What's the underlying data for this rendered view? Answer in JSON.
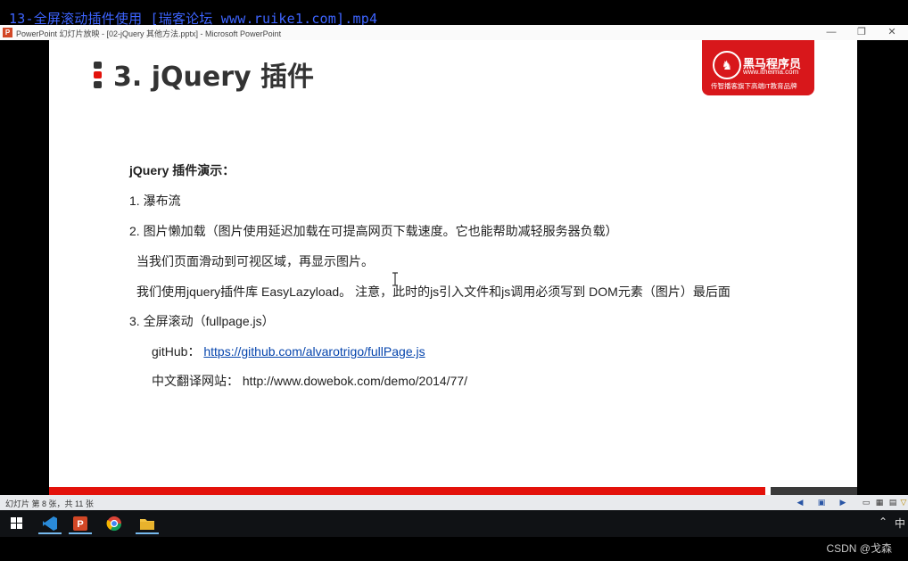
{
  "video_title": "13-全屏滚动插件使用_[瑞客论坛 www.ruike1.com].mp4",
  "window": {
    "title": "PowerPoint 幻灯片放映 - [02-jQuery 其他方法.pptx] - Microsoft PowerPoint",
    "app_icon": "P",
    "minimize": "—",
    "restore": "❐",
    "close": "✕"
  },
  "slide": {
    "title": "3. jQuery 插件",
    "logo": {
      "name": "黑马程序员",
      "url": "www.itheima.com",
      "slogan": "传智播客旗下高端IT教育品牌"
    },
    "heading": "jQuery 插件演示：",
    "item1": "1. 瀑布流",
    "item2": "2. 图片懒加载（图片使用延迟加载在可提高网页下载速度。它也能帮助减轻服务器负载）",
    "item2_line1": "当我们页面滑动到可视区域，再显示图片。",
    "item2_line2": "我们使用jquery插件库  EasyLazyload。 注意，此时的js引入文件和js调用必须写到 DOM元素（图片）最后面",
    "item3": "3. 全屏滚动（fullpage.js）",
    "github_label": "gitHub：",
    "github_link": "https://github.com/alvarotrigo/fullPage.js",
    "cn_label": "中文翻译网站：",
    "cn_url": "http://www.dowebok.com/demo/2014/77/"
  },
  "status": {
    "slide_info": "幻灯片 第 8 张，共 11 张"
  },
  "taskbar": {
    "ime": "中"
  },
  "watermark": "CSDN @戈森",
  "colors": {
    "accent_red": "#e3120b",
    "link": "#0645ad",
    "logo_red": "#d8171b"
  }
}
